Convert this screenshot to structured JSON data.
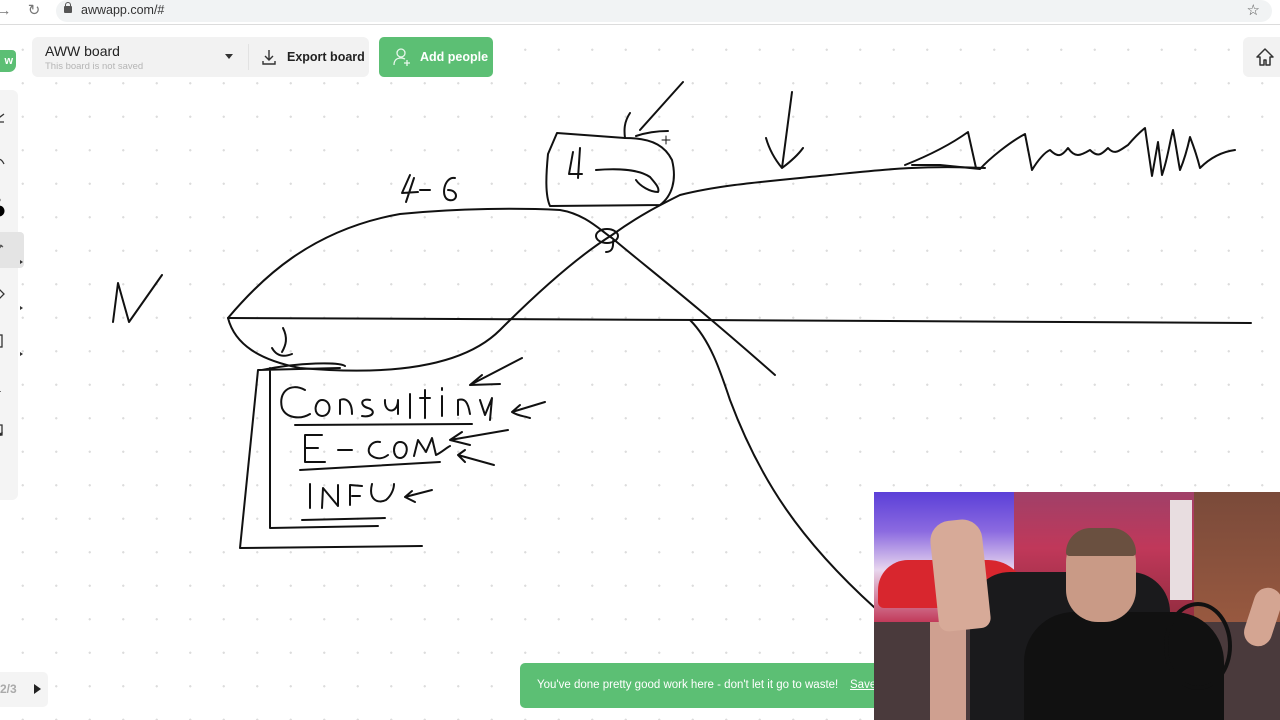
{
  "browser": {
    "url": "awwapp.com/#",
    "back_icon": "arrow-right-icon",
    "reload_icon": "reload-icon",
    "bookmark_icon": "star-icon"
  },
  "app": {
    "logo_text": "w",
    "board_name": "AWW board",
    "board_status": "This board is not saved",
    "export_label": "Export board",
    "add_people_label": "Add people",
    "brand_color": "#5cbf74"
  },
  "toolbar": {
    "tools": [
      {
        "name": "select-tool",
        "icon": "cursor-icon"
      },
      {
        "name": "pen-curve-tool",
        "icon": "curve-icon"
      },
      {
        "name": "color-picker",
        "icon": "color-dot-icon",
        "color": "#000000"
      },
      {
        "name": "pencil-tool",
        "icon": "pencil-icon",
        "active": true
      },
      {
        "name": "eraser-tool",
        "icon": "eraser-icon"
      },
      {
        "name": "shape-tool",
        "icon": "rectangle-icon"
      },
      {
        "name": "text-tool",
        "icon": "text-icon",
        "label": "a"
      },
      {
        "name": "sticky-note-tool",
        "icon": "sticky-note-icon"
      },
      {
        "name": "line-tool",
        "icon": "line-icon"
      }
    ]
  },
  "pagination": {
    "label": "2/3"
  },
  "toast": {
    "message": "You've done pretty good work here - don't let it go to waste!",
    "action": "Save"
  },
  "drawing": {
    "handwritten_labels": [
      "N",
      "4-6",
      "4",
      "CONSULTING",
      "E-COM",
      "INFO"
    ]
  }
}
